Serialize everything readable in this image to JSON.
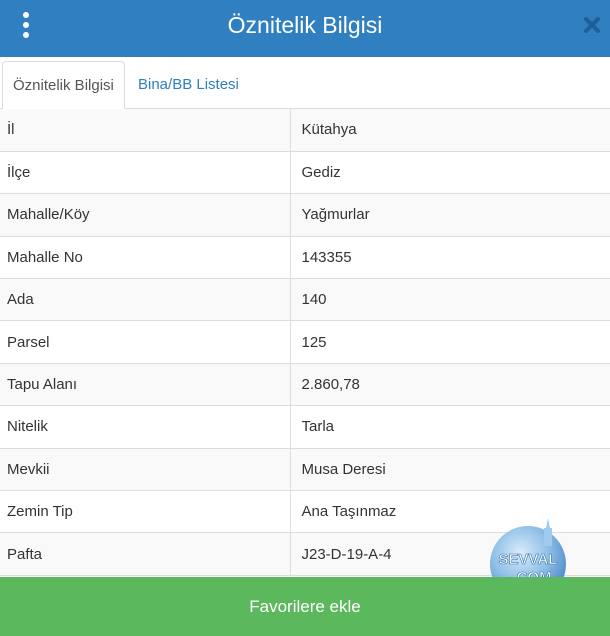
{
  "header": {
    "title": "Öznitelik Bilgisi",
    "menu_icon": "vertical-dots-icon",
    "close_icon": "close-x-icon",
    "bg_color": "#2f7fc1"
  },
  "tabs": [
    {
      "label": "Öznitelik Bilgisi",
      "active": true
    },
    {
      "label": "Bina/BB Listesi",
      "active": false
    }
  ],
  "attributes": [
    {
      "key": "İl",
      "value": "Kütahya"
    },
    {
      "key": "İlçe",
      "value": "Gediz"
    },
    {
      "key": "Mahalle/Köy",
      "value": "Yağmurlar"
    },
    {
      "key": "Mahalle No",
      "value": "143355"
    },
    {
      "key": "Ada",
      "value": "140"
    },
    {
      "key": "Parsel",
      "value": "125"
    },
    {
      "key": "Tapu Alanı",
      "value": "2.860,78"
    },
    {
      "key": "Nitelik",
      "value": "Tarla"
    },
    {
      "key": "Mevkii",
      "value": "Musa Deresi"
    },
    {
      "key": "Zemin Tip",
      "value": "Ana Taşınmaz"
    },
    {
      "key": "Pafta",
      "value": "J23-D-19-A-4"
    }
  ],
  "watermark": {
    "line1": "SEVVAL",
    "line2": ".COM"
  },
  "footer": {
    "favorite_label": "Favorilere ekle",
    "button_color": "#5cb85c"
  }
}
